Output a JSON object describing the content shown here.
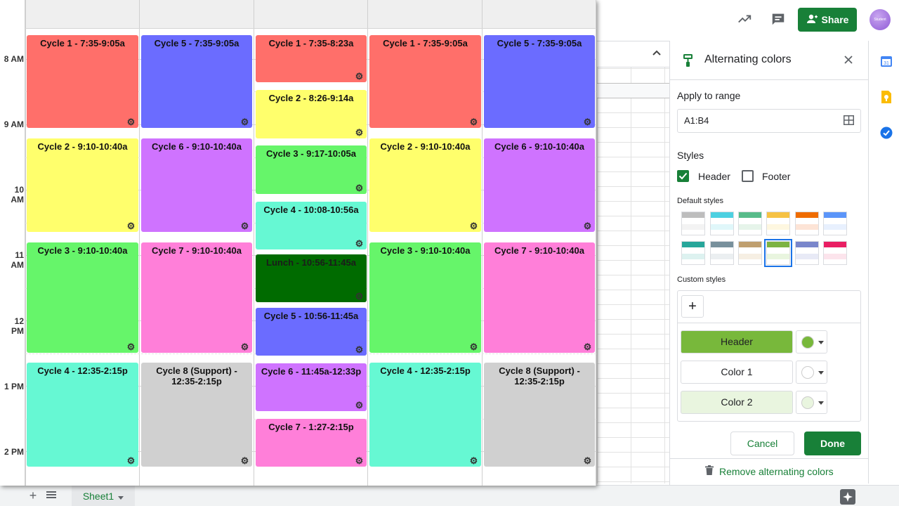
{
  "colors": {
    "sheets_green": "#188038",
    "accent_blue": "#1a73e8"
  },
  "toolbar": {
    "trend_icon": "trending-up-icon",
    "comment_icon": "comment-icon",
    "share_label": "Share",
    "avatar_text": "Student"
  },
  "calendar": {
    "time_labels": [
      "8 AM",
      "9 AM",
      "10 AM",
      "11 AM",
      "12 PM",
      "1 PM",
      "2 PM"
    ],
    "events": [
      {
        "label": "Cycle 1 - 7:35-9:05a",
        "color": "#ff6f6a",
        "text_color": "#111"
      },
      {
        "label": "Cycle 2 - 9:10-10:40a",
        "color": "#ffff6c",
        "text_color": "#111"
      },
      {
        "label": "Cycle 3 - 9:10-10:40a",
        "color": "#66f56a",
        "text_color": "#111"
      },
      {
        "label": "Cycle 4 - 12:35-2:15p",
        "color": "#66f8d3",
        "text_color": "#111"
      },
      {
        "label": "Cycle 5 - 7:35-9:05a",
        "color": "#6b6cff",
        "text_color": "#111"
      },
      {
        "label": "Cycle 6 - 9:10-10:40a",
        "color": "#cf73ff",
        "text_color": "#111"
      },
      {
        "label": "Cycle 7 - 9:10-10:40a",
        "color": "#ff7fd9",
        "text_color": "#111"
      },
      {
        "label": "Cycle 8 (Support) - 12:35-2:15p",
        "color": "#d0d0d0",
        "text_color": "#111"
      },
      {
        "label": "Cycle 1 - 7:35-8:23a",
        "color": "#ff6f6a",
        "text_color": "#111"
      },
      {
        "label": "Cycle 2 - 8:26-9:14a",
        "color": "#ffff6c",
        "text_color": "#111"
      },
      {
        "label": "Cycle 3 - 9:17-10:05a",
        "color": "#66f56a",
        "text_color": "#111"
      },
      {
        "label": "Cycle 4 - 10:08-10:56a",
        "color": "#66f8d3",
        "text_color": "#111"
      },
      {
        "label": "Lunch - 10:56-11:45a",
        "color": "#006b00",
        "text_color": "#1b1b1b"
      },
      {
        "label": "Cycle 5 - 10:56-11:45a",
        "color": "#6b6cff",
        "text_color": "#111"
      },
      {
        "label": "Cycle 6 - 11:45a-12:33p",
        "color": "#cf73ff",
        "text_color": "#111"
      },
      {
        "label": "Cycle 7 - 1:27-2:15p",
        "color": "#ff7fd9",
        "text_color": "#111"
      },
      {
        "label": "Cycle 1 - 7:35-9:05a",
        "color": "#ff6f6a",
        "text_color": "#111"
      },
      {
        "label": "Cycle 2 - 9:10-10:40a",
        "color": "#ffff6c",
        "text_color": "#111"
      },
      {
        "label": "Cycle 3 - 9:10-10:40a",
        "color": "#66f56a",
        "text_color": "#111"
      },
      {
        "label": "Cycle 4 - 12:35-2:15p",
        "color": "#66f8d3",
        "text_color": "#111"
      },
      {
        "label": "Cycle 5 - 7:35-9:05a",
        "color": "#6b6cff",
        "text_color": "#111"
      },
      {
        "label": "Cycle 6 - 9:10-10:40a",
        "color": "#cf73ff",
        "text_color": "#111"
      },
      {
        "label": "Cycle 7 - 9:10-10:40a",
        "color": "#ff7fd9",
        "text_color": "#111"
      },
      {
        "label": "Cycle 8 (Support) - 12:35-2:15p",
        "color": "#d0d0d0",
        "text_color": "#111"
      }
    ]
  },
  "panel": {
    "title": "Alternating colors",
    "apply_label": "Apply to range",
    "range_value": "A1:B4",
    "styles_label": "Styles",
    "header_checkbox": {
      "label": "Header",
      "checked": true
    },
    "footer_checkbox": {
      "label": "Footer",
      "checked": false
    },
    "default_styles_label": "Default styles",
    "default_styles": [
      {
        "header": "#bdbdbd",
        "alt": "#f3f3f3",
        "selected": false
      },
      {
        "header": "#4dd0e1",
        "alt": "#e0f7fa",
        "selected": false
      },
      {
        "header": "#57bb8a",
        "alt": "#e6f4ea",
        "selected": false
      },
      {
        "header": "#f6c244",
        "alt": "#fef7e0",
        "selected": false
      },
      {
        "header": "#ef6c00",
        "alt": "#fde4d6",
        "selected": false
      },
      {
        "header": "#5b95f9",
        "alt": "#e8f0fe",
        "selected": false
      },
      {
        "header": "#26a69a",
        "alt": "#ddf2f0",
        "selected": false
      },
      {
        "header": "#78909c",
        "alt": "#ebeff1",
        "selected": false
      },
      {
        "header": "#bf9f6f",
        "alt": "#f6efe3",
        "selected": false
      },
      {
        "header": "#7cb342",
        "alt": "#e9f5df",
        "selected": true
      },
      {
        "header": "#7986cb",
        "alt": "#e8eaf6",
        "selected": false
      },
      {
        "header": "#e91e63",
        "alt": "#fce4ec",
        "selected": false
      }
    ],
    "custom_styles_label": "Custom styles",
    "add_label": "+",
    "color_rows": [
      {
        "label": "Header",
        "bg": "#78b83b",
        "swatch": "#78b83b"
      },
      {
        "label": "Color 1",
        "bg": "#ffffff",
        "swatch": "#ffffff"
      },
      {
        "label": "Color 2",
        "bg": "#e9f5df",
        "swatch": "#e9f5df"
      }
    ],
    "cancel_label": "Cancel",
    "done_label": "Done",
    "remove_label": "Remove alternating colors"
  },
  "bottom": {
    "sheet_tab": "Sheet1",
    "add_sheet": "+"
  }
}
